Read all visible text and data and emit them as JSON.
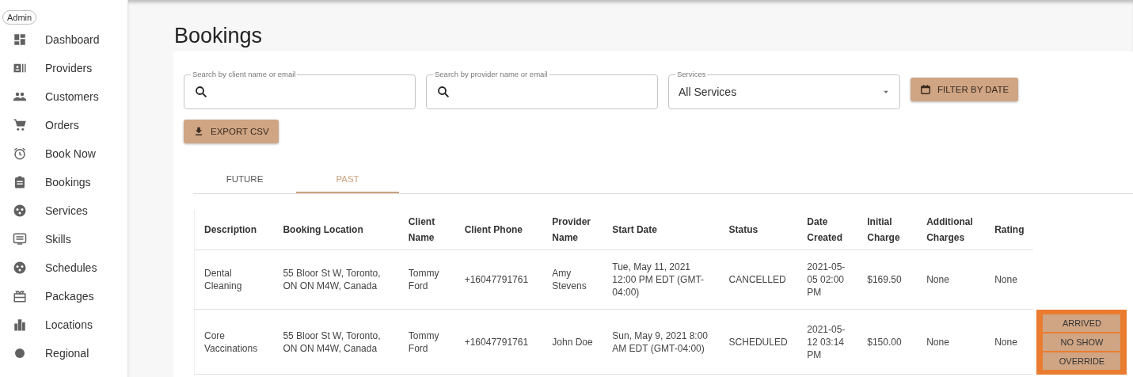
{
  "sidebar": {
    "badge": "Admin",
    "items": [
      {
        "label": "Dashboard"
      },
      {
        "label": "Providers"
      },
      {
        "label": "Customers"
      },
      {
        "label": "Orders"
      },
      {
        "label": "Book Now"
      },
      {
        "label": "Bookings"
      },
      {
        "label": "Services"
      },
      {
        "label": "Skills"
      },
      {
        "label": "Schedules"
      },
      {
        "label": "Packages"
      },
      {
        "label": "Locations"
      },
      {
        "label": "Regional"
      }
    ]
  },
  "page_title": "Bookings",
  "filters": {
    "client_search": {
      "label": "Search by client name or email"
    },
    "provider_search": {
      "label": "Search by provider name or email"
    },
    "services_select": {
      "label": "Services",
      "value": "All Services"
    },
    "filter_button": "FILTER BY DATE",
    "export_button": "EXPORT CSV"
  },
  "tabs": [
    {
      "label": "FUTURE",
      "selected": false
    },
    {
      "label": "PAST",
      "selected": true
    }
  ],
  "table": {
    "columns": [
      "Description",
      "Booking Location",
      "Client Name",
      "Client Phone",
      "Provider Name",
      "Start Date",
      "Status",
      "Date Created",
      "Initial Charge",
      "Additional Charges",
      "Rating"
    ],
    "rows": [
      {
        "cells": [
          "Dental Cleaning",
          "55 Bloor St W, Toronto, ON ON M4W, Canada",
          "Tommy Ford",
          "+16047791761",
          "Amy Stevens",
          "Tue, May 11, 2021 12:00 PM EDT (GMT-04:00)",
          "CANCELLED",
          "2021-05-05 02:00 PM",
          "$169.50",
          "None",
          "None"
        ],
        "actions": []
      },
      {
        "cells": [
          "Core Vaccinations",
          "55 Bloor St W, Toronto, ON ON M4W, Canada",
          "Tommy Ford",
          "+16047791761",
          "John Doe",
          "Sun, May 9, 2021 8:00 AM EDT (GMT-04:00)",
          "SCHEDULED",
          "2021-05-12 03:14 PM",
          "$150.00",
          "None",
          "None"
        ],
        "actions": [
          "ARRIVED",
          "NO SHOW",
          "OVERRIDE"
        ]
      }
    ]
  }
}
